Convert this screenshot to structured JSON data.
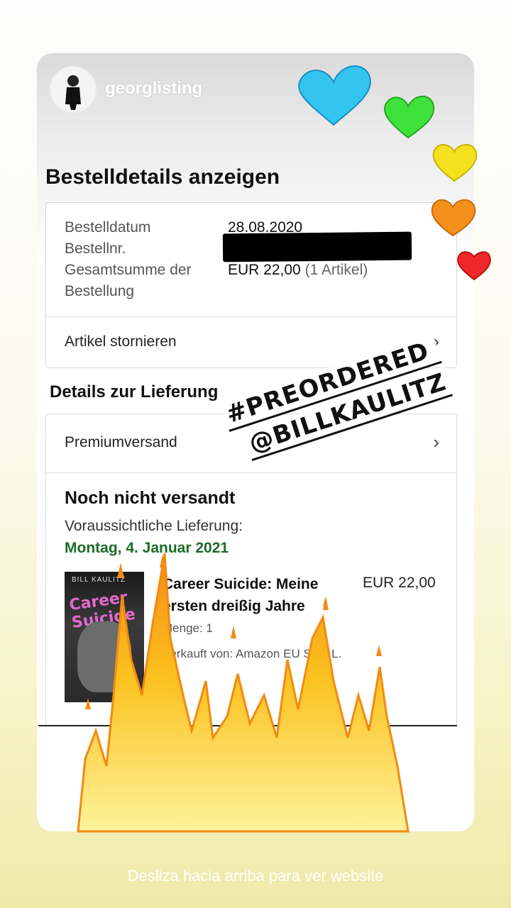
{
  "story": {
    "username": "georglisting",
    "swipe_up": "Desliza hacia arriba para ver website"
  },
  "order": {
    "page_title": "Bestelldetails anzeigen",
    "date_label": "Bestelldatum",
    "date_value": "28.08.2020",
    "number_label": "Bestellnr.",
    "total_label_1": "Gesamtsumme der",
    "total_label_2": "Bestellung",
    "total_value": "EUR 22,00",
    "total_items": "(1 Artikel)",
    "cancel_label": "Artikel stornieren"
  },
  "delivery": {
    "section_title": "Details zur Lieferung",
    "shipping": "Premiumversand",
    "status": "Noch nicht versandt",
    "est_label": "Voraussichtliche Lieferung:",
    "est_date": "Montag, 4. Januar 2021"
  },
  "item": {
    "title": "Career Suicide: Meine ersten dreißig Jahre",
    "price": "EUR 22,00",
    "quantity": "Menge: 1",
    "seller": "Verkauft von: Amazon EU S.a.r.L.",
    "cover_author": "BILL KAULITZ",
    "cover_title": "Career Suicide"
  },
  "stickers": {
    "tag1": "#PREORDERED",
    "tag2": "@BILLKAULITZ",
    "heart_colors": [
      "#33c4f0",
      "#3ee23a",
      "#f5e020",
      "#f5901c",
      "#ee2828"
    ],
    "fire_color": "#f7a21b"
  }
}
